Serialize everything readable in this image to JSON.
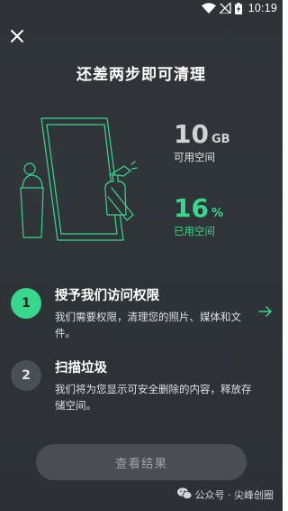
{
  "status_bar": {
    "time": "10:19",
    "icons": [
      "wifi-icon",
      "no-signal-icon",
      "battery-charging-icon"
    ]
  },
  "close": {
    "icon": "close-icon"
  },
  "title": "还差两步即可清理",
  "storage": {
    "free_value": "10",
    "free_unit": "GB",
    "free_label": "可用空间",
    "used_value": "16",
    "used_unit": "%",
    "used_label": "已用空间",
    "accent_color": "#37d88b"
  },
  "steps": [
    {
      "number": "1",
      "title": "授予我们访问权限",
      "description": "我们需要权限，清理您的照片、媒体和文件。",
      "active": true
    },
    {
      "number": "2",
      "title": "扫描垃圾",
      "description": "我们将为您显示可安全删除的内容，释放存储空间。",
      "active": false
    }
  ],
  "result_button_label": "查看结果",
  "watermark": "公众号 · 尖峰创圈"
}
